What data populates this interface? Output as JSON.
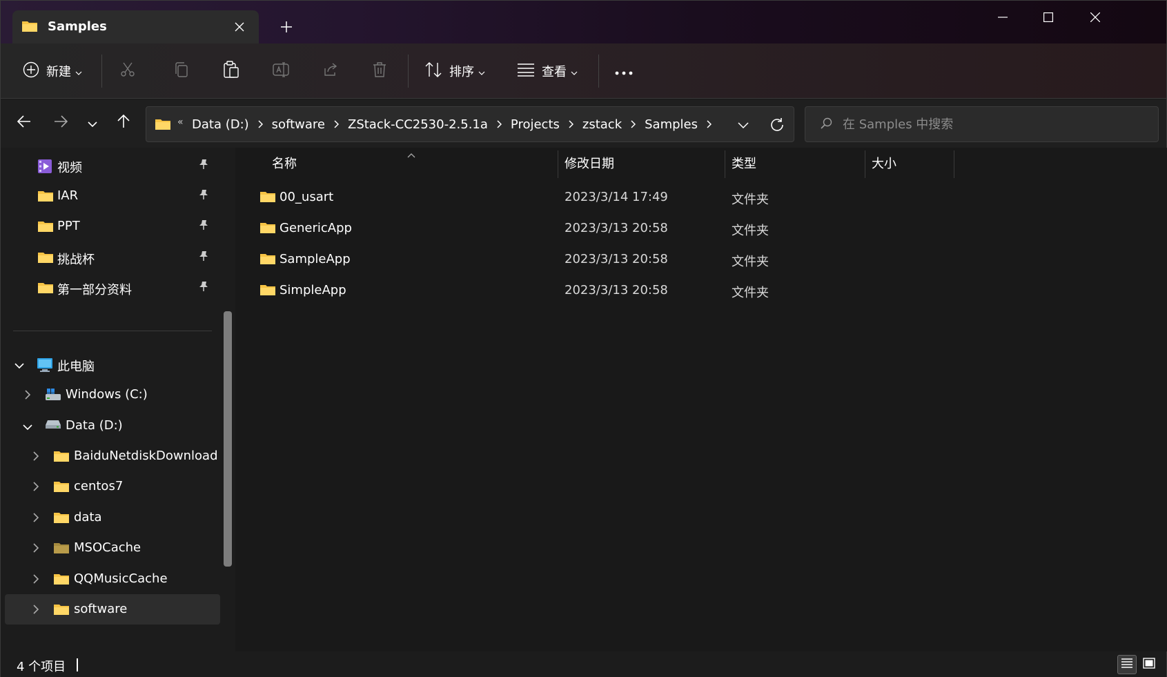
{
  "tab": {
    "title": "Samples"
  },
  "toolbar": {
    "new_label": "新建",
    "sort_label": "排序",
    "view_label": "查看"
  },
  "address": {
    "crumbs": [
      "Data (D:)",
      "software",
      "ZStack-CC2530-2.5.1a",
      "Projects",
      "zstack",
      "Samples"
    ]
  },
  "search": {
    "placeholder": "在 Samples 中搜索"
  },
  "sidebar": {
    "quick_access": [
      {
        "label": "视频",
        "icon": "video-folder-icon"
      },
      {
        "label": "IAR",
        "icon": "folder-icon"
      },
      {
        "label": "PPT",
        "icon": "folder-icon"
      },
      {
        "label": "挑战杯",
        "icon": "folder-icon"
      },
      {
        "label": "第一部分资料",
        "icon": "folder-icon"
      }
    ],
    "this_pc": "此电脑",
    "drives": [
      "Windows (C:)",
      "Data (D:)"
    ],
    "d_folders": [
      "BaiduNetdiskDownload",
      "centos7",
      "data",
      "MSOCache",
      "QQMusicCache",
      "software"
    ]
  },
  "columns": {
    "name": "名称",
    "date": "修改日期",
    "type": "类型",
    "size": "大小"
  },
  "files": [
    {
      "name": "00_usart",
      "date": "2023/3/14 17:49",
      "type": "文件夹"
    },
    {
      "name": "GenericApp",
      "date": "2023/3/13 20:58",
      "type": "文件夹"
    },
    {
      "name": "SampleApp",
      "date": "2023/3/13 20:58",
      "type": "文件夹"
    },
    {
      "name": "SimpleApp",
      "date": "2023/3/13 20:58",
      "type": "文件夹"
    }
  ],
  "status": {
    "count": "4 个项目"
  },
  "colors": {
    "folder": "#f6c344",
    "accent_title": "#24152e"
  }
}
